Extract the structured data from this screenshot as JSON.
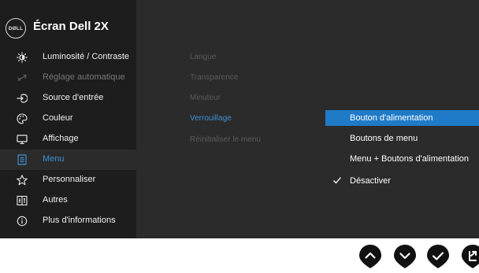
{
  "header": {
    "logo": "DØLL",
    "title": "Écran Dell 2X"
  },
  "menu": [
    {
      "label": "Luminosité / Contraste",
      "icon": "brightness-icon"
    },
    {
      "label": "Réglage automatique",
      "icon": "auto-adjust-icon",
      "state": "disabled"
    },
    {
      "label": "Source d'entrée",
      "icon": "input-source-icon"
    },
    {
      "label": "Couleur",
      "icon": "color-palette-icon"
    },
    {
      "label": "Affichage",
      "icon": "display-icon"
    },
    {
      "label": "Menu",
      "icon": "menu-icon",
      "state": "active"
    },
    {
      "label": "Personnaliser",
      "icon": "star-icon"
    },
    {
      "label": "Autres",
      "icon": "others-icon"
    },
    {
      "label": "Plus d'informations",
      "icon": "info-icon"
    }
  ],
  "submenu": [
    {
      "label": "Langue"
    },
    {
      "label": "Transparence"
    },
    {
      "label": "Minuteur"
    },
    {
      "label": "Verrouillage",
      "state": "active"
    },
    {
      "label": "Réinitialiser le menu"
    }
  ],
  "options": [
    {
      "label": "Bouton d'alimentation",
      "state": "highlighted"
    },
    {
      "label": "Boutons de menu"
    },
    {
      "label": "Menu + Boutons d'alimentation"
    },
    {
      "label": "Désactiver",
      "checked": true
    }
  ],
  "nav_buttons": [
    "up-arrow-icon",
    "down-arrow-icon",
    "checkmark-icon",
    "back-exit-icon"
  ],
  "colors": {
    "accent": "#3f8fd2",
    "highlight": "#1f7bc8",
    "sidebar": "#1d1d1d",
    "panel": "#2b2b2b"
  }
}
